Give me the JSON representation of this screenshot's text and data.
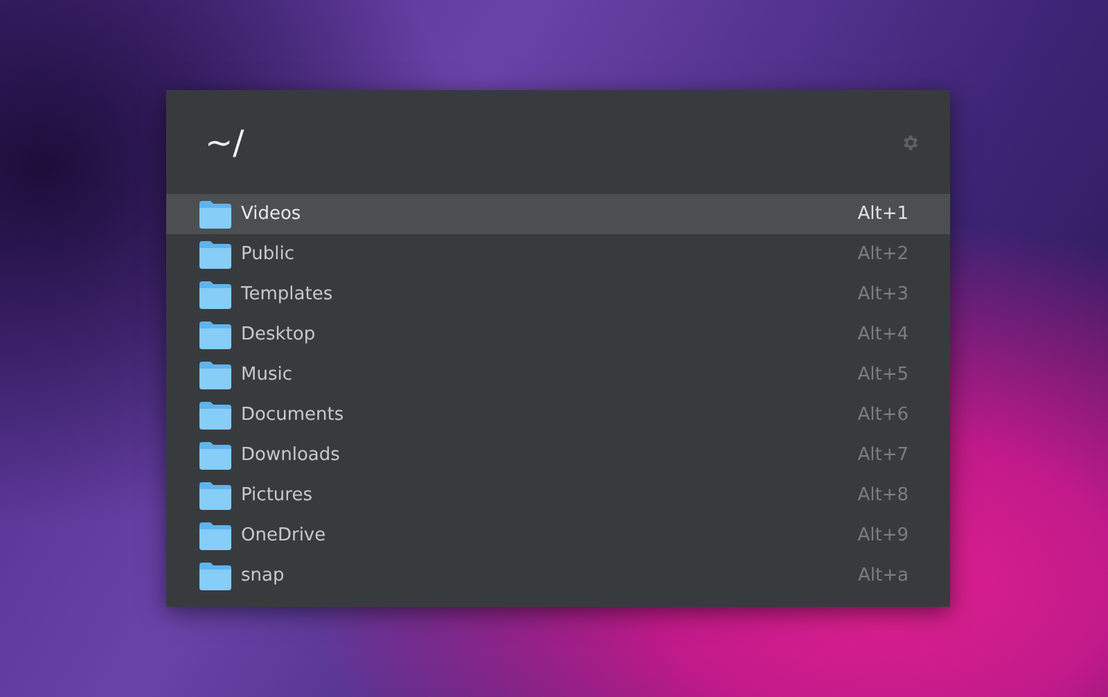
{
  "search": {
    "value": "~/"
  },
  "items": [
    {
      "name": "Videos",
      "shortcut": "Alt+1",
      "selected": true
    },
    {
      "name": "Public",
      "shortcut": "Alt+2",
      "selected": false
    },
    {
      "name": "Templates",
      "shortcut": "Alt+3",
      "selected": false
    },
    {
      "name": "Desktop",
      "shortcut": "Alt+4",
      "selected": false
    },
    {
      "name": "Music",
      "shortcut": "Alt+5",
      "selected": false
    },
    {
      "name": "Documents",
      "shortcut": "Alt+6",
      "selected": false
    },
    {
      "name": "Downloads",
      "shortcut": "Alt+7",
      "selected": false
    },
    {
      "name": "Pictures",
      "shortcut": "Alt+8",
      "selected": false
    },
    {
      "name": "OneDrive",
      "shortcut": "Alt+9",
      "selected": false
    },
    {
      "name": "snap",
      "shortcut": "Alt+a",
      "selected": false
    }
  ]
}
